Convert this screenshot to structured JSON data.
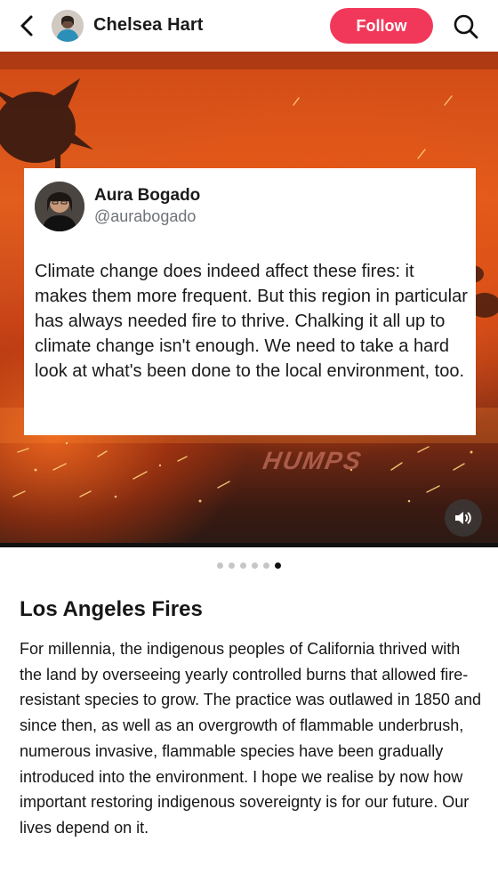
{
  "header": {
    "back_icon": "chevron-left-icon",
    "author_name": "Chelsea Hart",
    "follow_label": "Follow",
    "search_icon": "search-icon",
    "accent_color": "#f2385a"
  },
  "media": {
    "watermark": "HUMPS",
    "sound_icon": "speaker-icon",
    "quote": {
      "name": "Aura Bogado",
      "handle": "@aurabogado",
      "text": "Climate change does indeed affect these fires: it makes them more frequent. But this region in particular has always needed fire to thrive. Chalking it all up to climate change isn't enough. We need to take a hard look at what's been done to the local environment, too."
    }
  },
  "pager": {
    "count": 6,
    "active_index": 5
  },
  "post": {
    "title": "Los Angeles Fires",
    "body": "For millennia, the indigenous peoples of California thrived with the land by overseeing yearly controlled burns that allowed fire-resistant species to grow. The practice was outlawed in 1850 and since then, as well as an overgrowth of flammable underbrush, numerous invasive, flammable species have been gradually introduced into the environment. I hope we realise by now how important restoring indigenous sovereignty is for our future. Our lives depend on it."
  }
}
